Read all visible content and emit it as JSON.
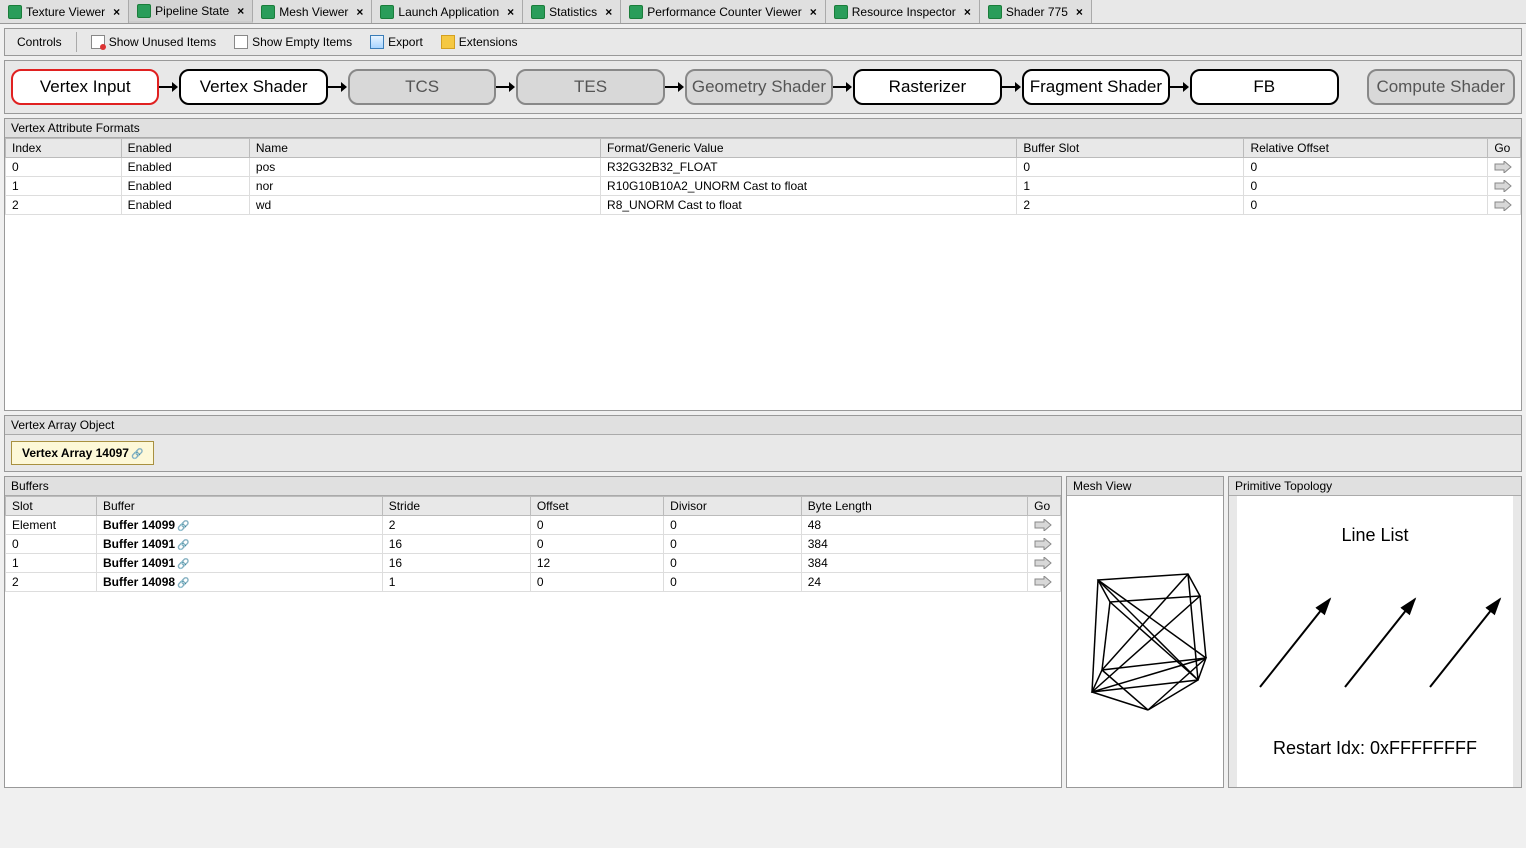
{
  "tabs": [
    {
      "label": "Texture Viewer",
      "active": false
    },
    {
      "label": "Pipeline State",
      "active": true
    },
    {
      "label": "Mesh Viewer",
      "active": false
    },
    {
      "label": "Launch Application",
      "active": false
    },
    {
      "label": "Statistics",
      "active": false
    },
    {
      "label": "Performance Counter Viewer",
      "active": false
    },
    {
      "label": "Resource Inspector",
      "active": false
    },
    {
      "label": "Shader 775",
      "active": false
    }
  ],
  "toolbar": {
    "controls": "Controls",
    "show_unused": "Show Unused Items",
    "show_empty": "Show Empty Items",
    "export": "Export",
    "extensions": "Extensions"
  },
  "pipeline": [
    {
      "label": "Vertex Input",
      "state": "selected"
    },
    {
      "label": "Vertex Shader",
      "state": "normal"
    },
    {
      "label": "TCS",
      "state": "disabled"
    },
    {
      "label": "TES",
      "state": "disabled"
    },
    {
      "label": "Geometry Shader",
      "state": "disabled"
    },
    {
      "label": "Rasterizer",
      "state": "normal"
    },
    {
      "label": "Fragment Shader",
      "state": "normal"
    },
    {
      "label": "FB",
      "state": "normal"
    },
    {
      "label": "Compute Shader",
      "state": "disabled",
      "detached": true
    }
  ],
  "vaf": {
    "title": "Vertex Attribute Formats",
    "headers": [
      "Index",
      "Enabled",
      "Name",
      "Format/Generic Value",
      "Buffer Slot",
      "Relative Offset",
      "Go"
    ],
    "rows": [
      {
        "index": "0",
        "enabled": "Enabled",
        "name": "pos",
        "format": "R32G32B32_FLOAT",
        "slot": "0",
        "offset": "0"
      },
      {
        "index": "1",
        "enabled": "Enabled",
        "name": "nor",
        "format": "R10G10B10A2_UNORM Cast to float",
        "slot": "1",
        "offset": "0"
      },
      {
        "index": "2",
        "enabled": "Enabled",
        "name": "wd",
        "format": "R8_UNORM Cast to float",
        "slot": "2",
        "offset": "0"
      }
    ]
  },
  "vao": {
    "title": "Vertex Array Object",
    "name": "Vertex Array 14097"
  },
  "buffers": {
    "title": "Buffers",
    "headers": [
      "Slot",
      "Buffer",
      "Stride",
      "Offset",
      "Divisor",
      "Byte Length",
      "Go"
    ],
    "rows": [
      {
        "slot": "Element",
        "buffer": "Buffer 14099",
        "stride": "2",
        "offset": "0",
        "divisor": "0",
        "len": "48"
      },
      {
        "slot": "0",
        "buffer": "Buffer 14091",
        "stride": "16",
        "offset": "0",
        "divisor": "0",
        "len": "384"
      },
      {
        "slot": "1",
        "buffer": "Buffer 14091",
        "stride": "16",
        "offset": "12",
        "divisor": "0",
        "len": "384"
      },
      {
        "slot": "2",
        "buffer": "Buffer 14098",
        "stride": "1",
        "offset": "0",
        "divisor": "0",
        "len": "24"
      }
    ]
  },
  "mesh_view": {
    "title": "Mesh View"
  },
  "topology": {
    "title": "Primitive Topology",
    "type": "Line List",
    "restart": "Restart Idx: 0xFFFFFFFF"
  }
}
